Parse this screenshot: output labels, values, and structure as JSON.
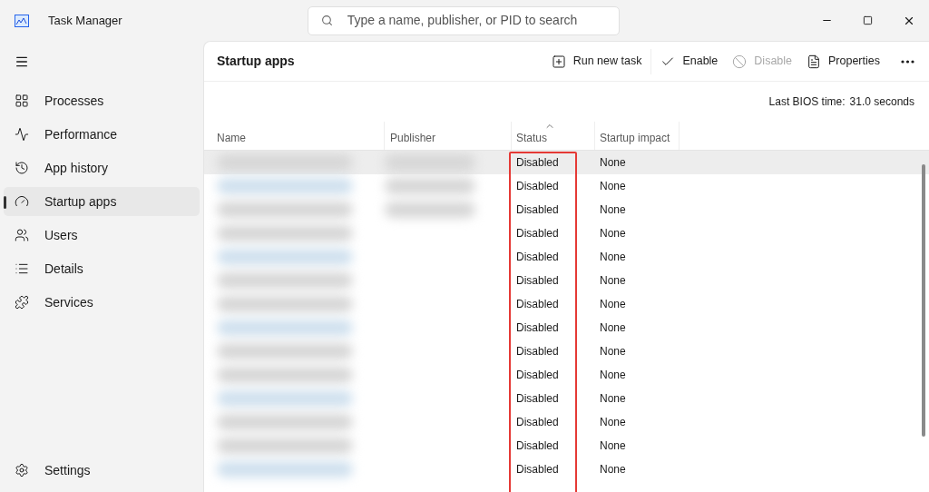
{
  "window": {
    "title": "Task Manager"
  },
  "search": {
    "placeholder": "Type a name, publisher, or PID to search"
  },
  "sidebar": {
    "items": [
      {
        "label": "Processes",
        "selected": false
      },
      {
        "label": "Performance",
        "selected": false
      },
      {
        "label": "App history",
        "selected": false
      },
      {
        "label": "Startup apps",
        "selected": true
      },
      {
        "label": "Users",
        "selected": false
      },
      {
        "label": "Details",
        "selected": false
      },
      {
        "label": "Services",
        "selected": false
      }
    ],
    "footer": {
      "label": "Settings"
    }
  },
  "page": {
    "title": "Startup apps"
  },
  "toolbar": [
    {
      "label": "Run new task",
      "disabled": false
    },
    {
      "label": "Enable",
      "disabled": false
    },
    {
      "label": "Disable",
      "disabled": true
    },
    {
      "label": "Properties",
      "disabled": false
    }
  ],
  "bios": {
    "label": "Last BIOS time:",
    "value": "31.0 seconds"
  },
  "table": {
    "columns": [
      {
        "label": "Name",
        "sorted": false
      },
      {
        "label": "Publisher",
        "sorted": false
      },
      {
        "label": "Status",
        "sorted": true
      },
      {
        "label": "Startup impact",
        "sorted": false
      }
    ],
    "rows": [
      {
        "status": "Disabled",
        "impact": "None",
        "selected": true
      },
      {
        "status": "Disabled",
        "impact": "None",
        "selected": false
      },
      {
        "status": "Disabled",
        "impact": "None",
        "selected": false
      },
      {
        "status": "Disabled",
        "impact": "None",
        "selected": false
      },
      {
        "status": "Disabled",
        "impact": "None",
        "selected": false
      },
      {
        "status": "Disabled",
        "impact": "None",
        "selected": false
      },
      {
        "status": "Disabled",
        "impact": "None",
        "selected": false
      },
      {
        "status": "Disabled",
        "impact": "None",
        "selected": false
      },
      {
        "status": "Disabled",
        "impact": "None",
        "selected": false
      },
      {
        "status": "Disabled",
        "impact": "None",
        "selected": false
      },
      {
        "status": "Disabled",
        "impact": "None",
        "selected": false
      },
      {
        "status": "Disabled",
        "impact": "None",
        "selected": false
      },
      {
        "status": "Disabled",
        "impact": "None",
        "selected": false
      },
      {
        "status": "Disabled",
        "impact": "None",
        "selected": false
      }
    ]
  }
}
